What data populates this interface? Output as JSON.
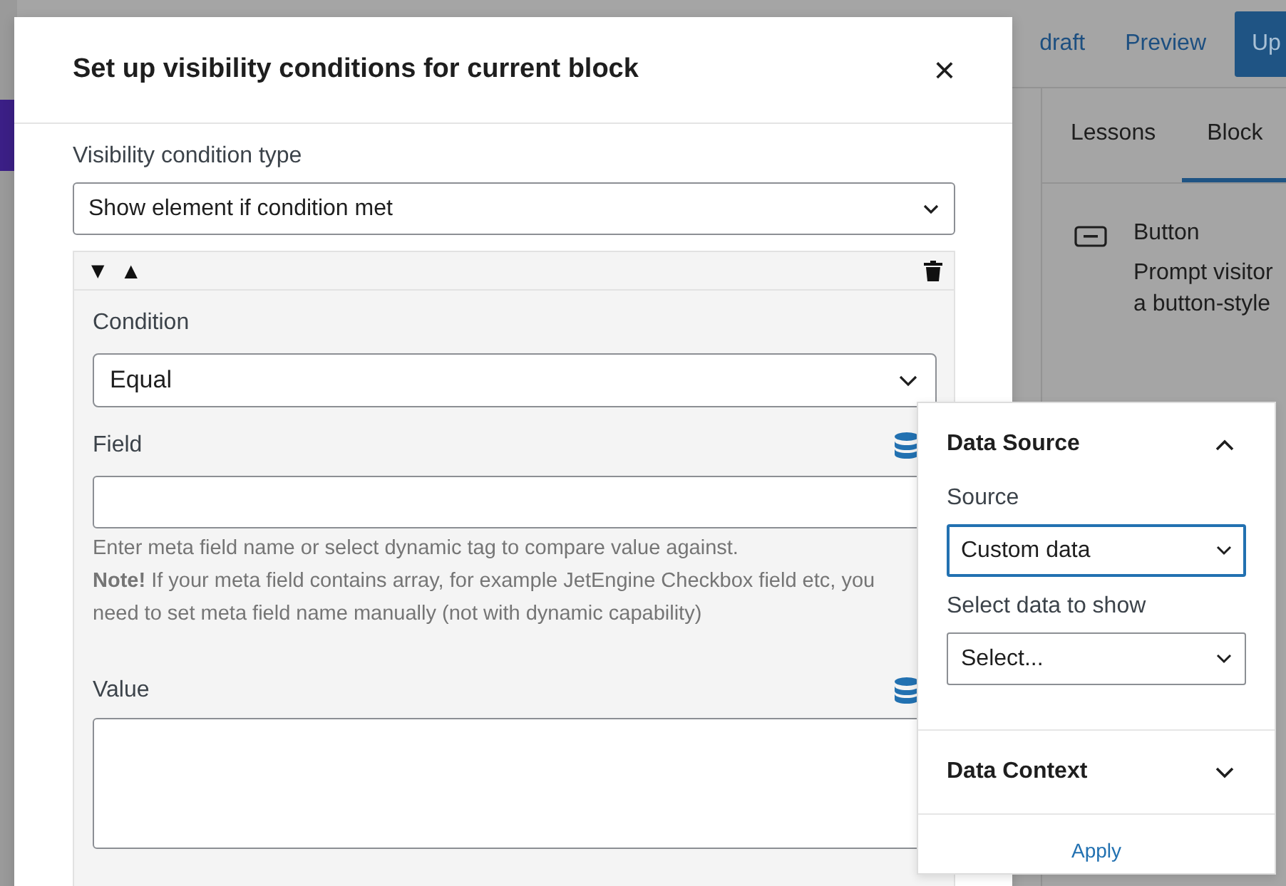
{
  "editor": {
    "top_bar": {
      "save_draft": "draft",
      "preview": "Preview",
      "update": "Up"
    },
    "sidebar": {
      "tabs": [
        {
          "label": "Lessons",
          "selected": false
        },
        {
          "label": "Block",
          "selected": true
        }
      ],
      "block_title": "Button",
      "block_description": [
        "Prompt visitor",
        "a button-style"
      ]
    }
  },
  "modal": {
    "title": "Set up visibility conditions for current block",
    "close": "×",
    "type_label": "Visibility condition type",
    "type_value": "Show element if condition met",
    "condition_item": {
      "move_down": "▼",
      "move_up": "▲",
      "condition_label": "Condition",
      "condition_value": "Equal",
      "field_label": "Field",
      "help": [
        "Enter meta field name or select dynamic tag to compare value against.",
        "**Note!** If your meta field contains array, for example JetEngine Checkbox field etc, you need to set meta field name manually (not with dynamic capability)"
      ],
      "value_label": "Value"
    }
  },
  "popover": {
    "sections": [
      {
        "title": "Data Source",
        "expanded": true,
        "fields": [
          {
            "label": "Source",
            "value": "Custom data",
            "focused": true
          },
          {
            "label": "Select data to show",
            "value": "Select...",
            "focused": false
          }
        ]
      },
      {
        "title": "Data Context",
        "expanded": false
      }
    ],
    "apply": "Apply"
  }
}
